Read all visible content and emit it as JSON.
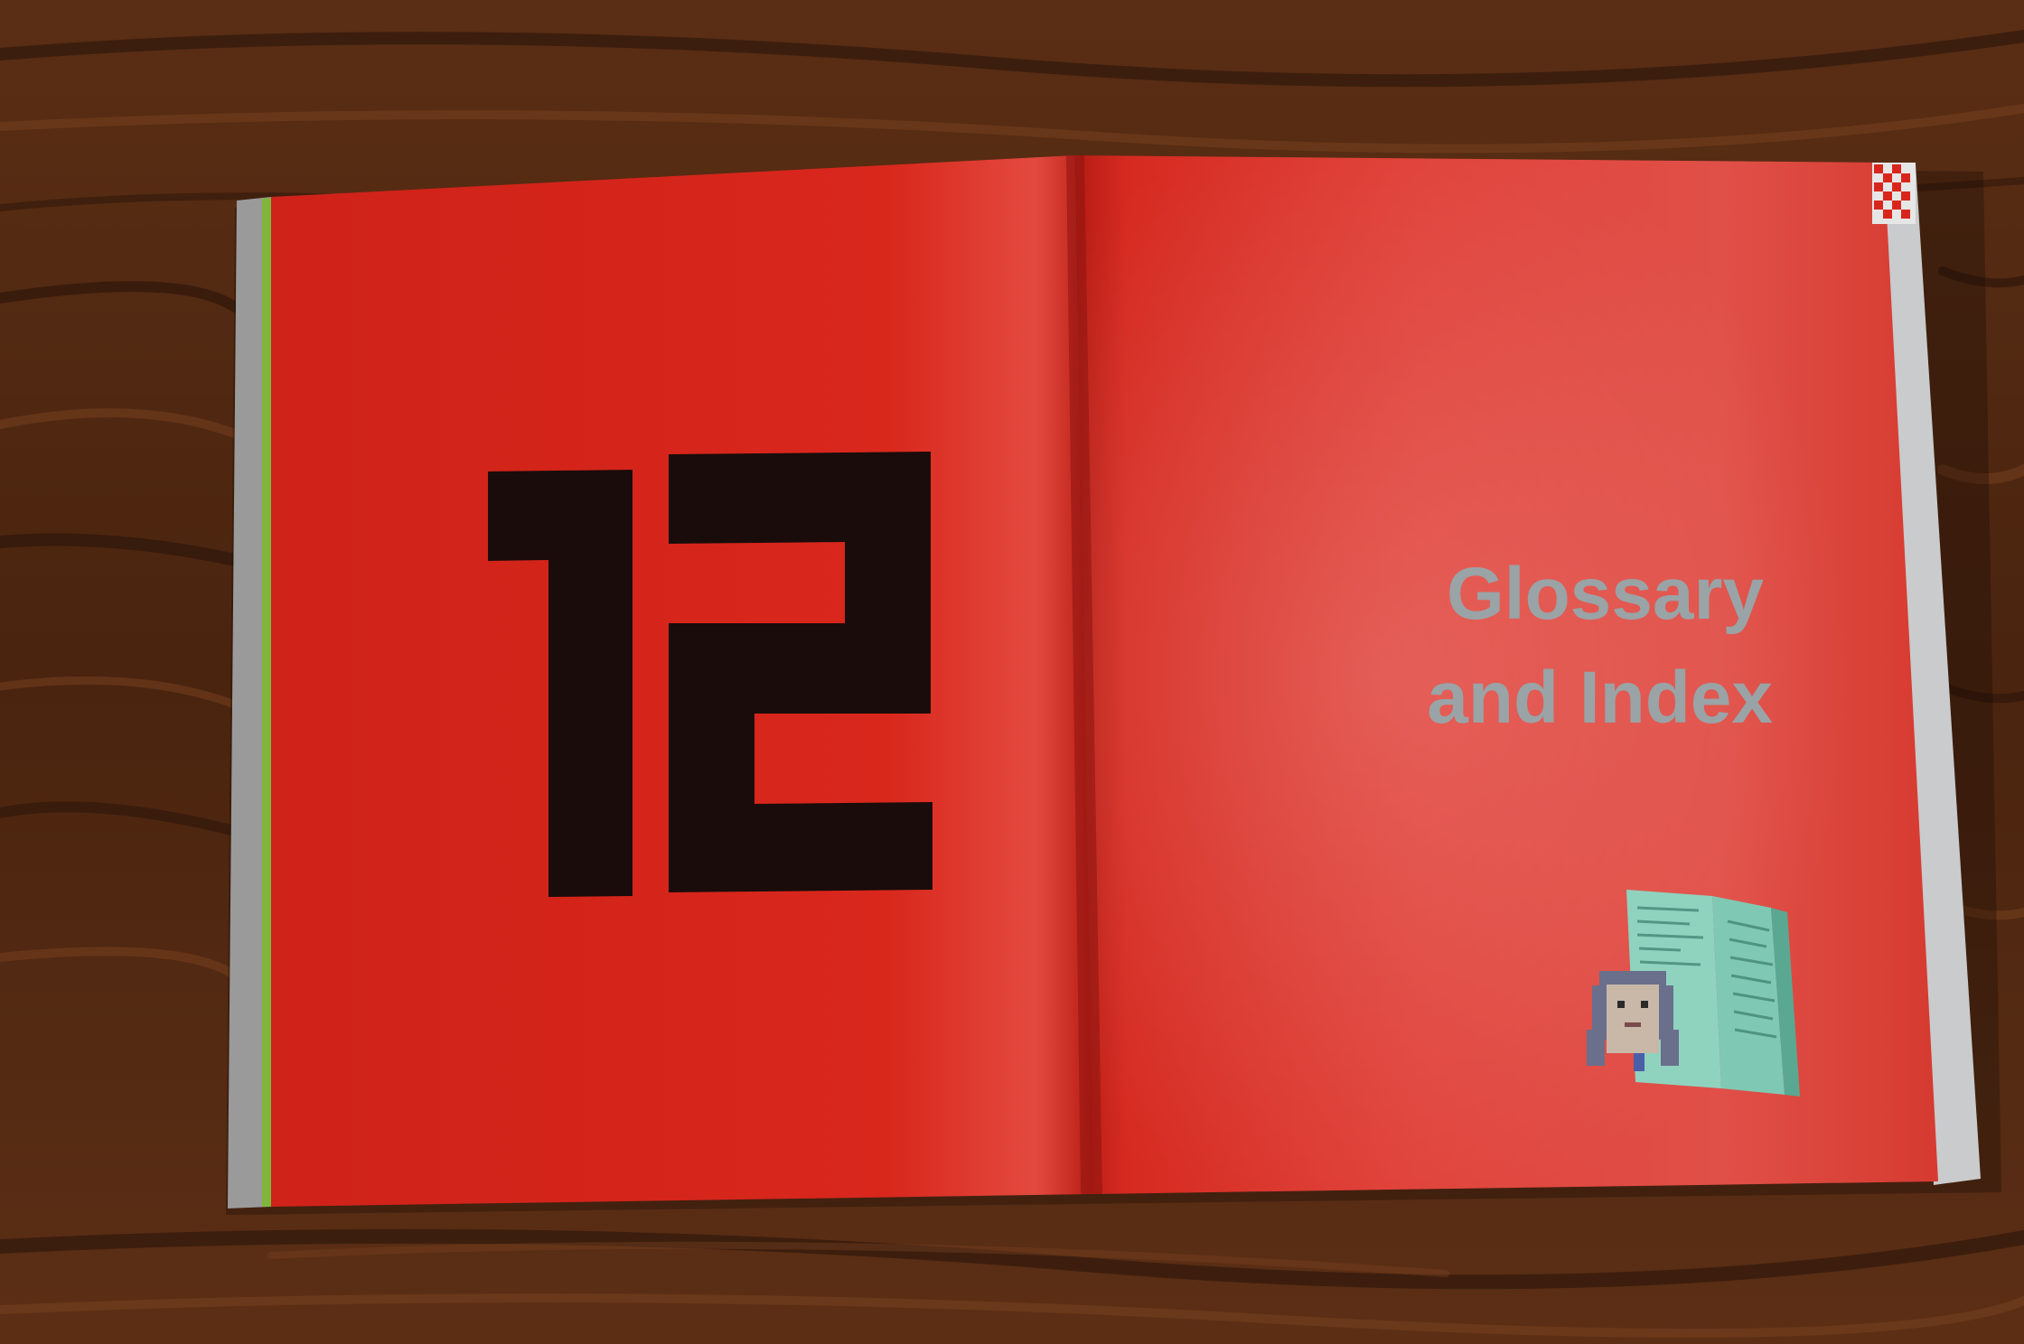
{
  "left_page": {
    "chapter_number": "12"
  },
  "right_page": {
    "title_line_1": "Glossary",
    "title_line_2": "and Index",
    "illustration": "pixel-art-person-with-book-illustration",
    "corner_mark": "checkered-corner-tab-icon"
  },
  "colors": {
    "page_red": "#d9261c",
    "number_black": "#1a0c0a",
    "title_gray": "#9aa3a6",
    "book_teal": "#7fc9b4",
    "wood_dark": "#2a140a",
    "wood_light": "#7a4220"
  }
}
